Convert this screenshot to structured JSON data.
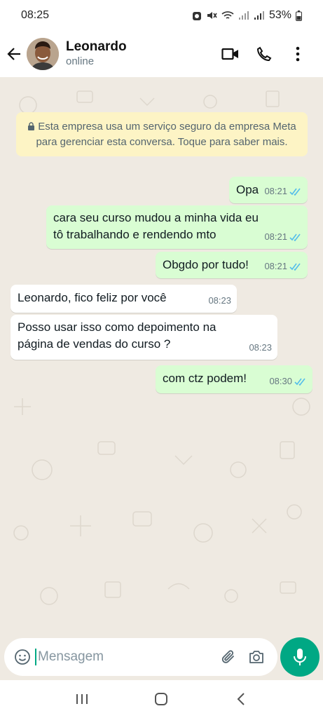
{
  "status_bar": {
    "time": "08:25",
    "battery": "53%"
  },
  "header": {
    "contact_name": "Leonardo",
    "contact_status": "online"
  },
  "chat": {
    "business_notice": "Esta empresa usa um serviço seguro da empresa Meta para gerenciar esta conversa. Toque para saber mais.",
    "messages": [
      {
        "direction": "outgoing",
        "text": "Opa",
        "time": "08:21",
        "status": "read"
      },
      {
        "direction": "outgoing",
        "text": "cara seu curso mudou a minha vida eu tô trabalhando e rendendo mto",
        "time": "08:21",
        "status": "read"
      },
      {
        "direction": "outgoing",
        "text": "Obgdo por tudo!",
        "time": "08:21",
        "status": "read"
      },
      {
        "direction": "incoming",
        "text": "Leonardo, fico feliz por você",
        "time": "08:23"
      },
      {
        "direction": "incoming",
        "text": "Posso usar isso como depoimento na página de vendas do curso ?",
        "time": "08:23"
      },
      {
        "direction": "outgoing",
        "text": "com ctz podem!",
        "time": "08:30",
        "status": "read"
      }
    ]
  },
  "composer": {
    "placeholder": "Mensagem"
  },
  "colors": {
    "accent": "#00a884",
    "outgoing_bubble": "#d9fdd3",
    "incoming_bubble": "#ffffff",
    "read_ticks": "#53bdeb",
    "notice_bg": "#fdf4c5",
    "wallpaper": "#efeae2"
  },
  "icons": {
    "header": [
      "back-arrow-icon",
      "video-call-icon",
      "voice-call-icon",
      "more-vertical-icon"
    ],
    "composer": [
      "emoji-icon",
      "attach-icon",
      "camera-icon",
      "mic-icon"
    ],
    "nav": [
      "recents-icon",
      "home-icon",
      "back-icon"
    ]
  }
}
